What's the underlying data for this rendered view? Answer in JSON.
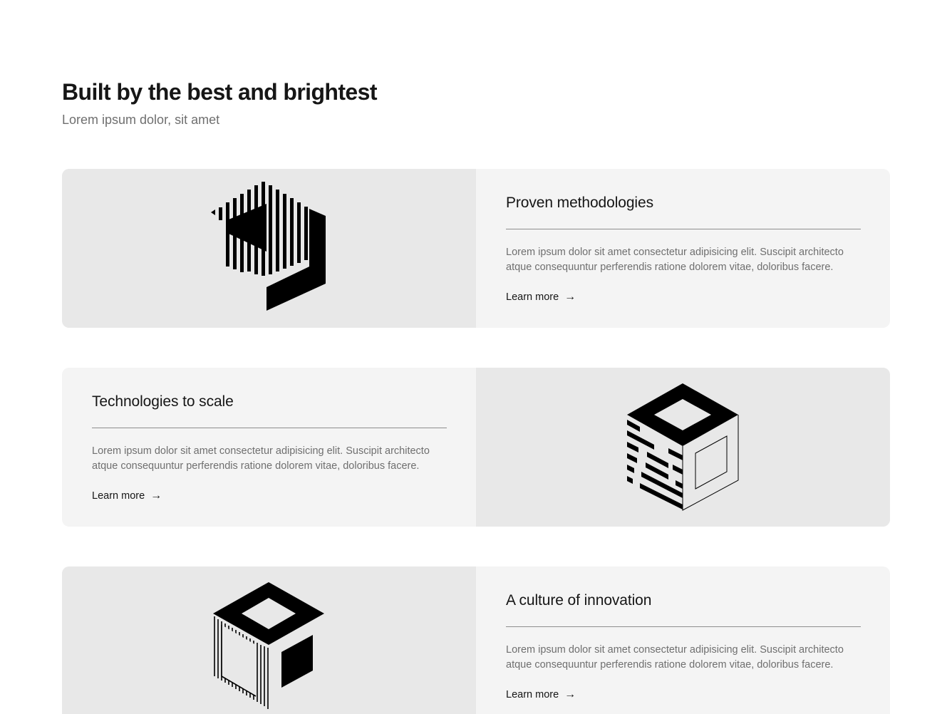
{
  "header": {
    "title": "Built by the best and brightest",
    "subtitle": "Lorem ipsum dolor, sit amet"
  },
  "cards": [
    {
      "title": "Proven methodologies",
      "text": "Lorem ipsum dolor sit amet consectetur adipisicing elit. Suscipit architecto atque consequuntur perferendis ratione dolorem vitae, doloribus facere.",
      "link_label": "Learn more",
      "link_icon": "arrow-right-icon",
      "illustration": "striped-shield-icon",
      "media_side": "left"
    },
    {
      "title": "Technologies to scale",
      "text": "Lorem ipsum dolor sit amet consectetur adipisicing elit. Suscipit architecto atque consequuntur perferendis ratione dolorem vitae, doloribus facere.",
      "link_label": "Learn more",
      "link_icon": "arrow-right-icon",
      "illustration": "striped-open-cube-icon",
      "media_side": "right"
    },
    {
      "title": "A culture of innovation",
      "text": "Lorem ipsum dolor sit amet consectetur adipisicing elit. Suscipit architecto atque consequuntur perferendis ratione dolorem vitae, doloribus facere.",
      "link_label": "Learn more",
      "link_icon": "arrow-right-icon",
      "illustration": "lined-cube-icon",
      "media_side": "left"
    }
  ],
  "colors": {
    "card_bg": "#f4f4f4",
    "media_bg": "#e8e8e8",
    "text_primary": "#161616",
    "text_secondary": "#6f6f6f",
    "divider": "#8d8d8d"
  }
}
